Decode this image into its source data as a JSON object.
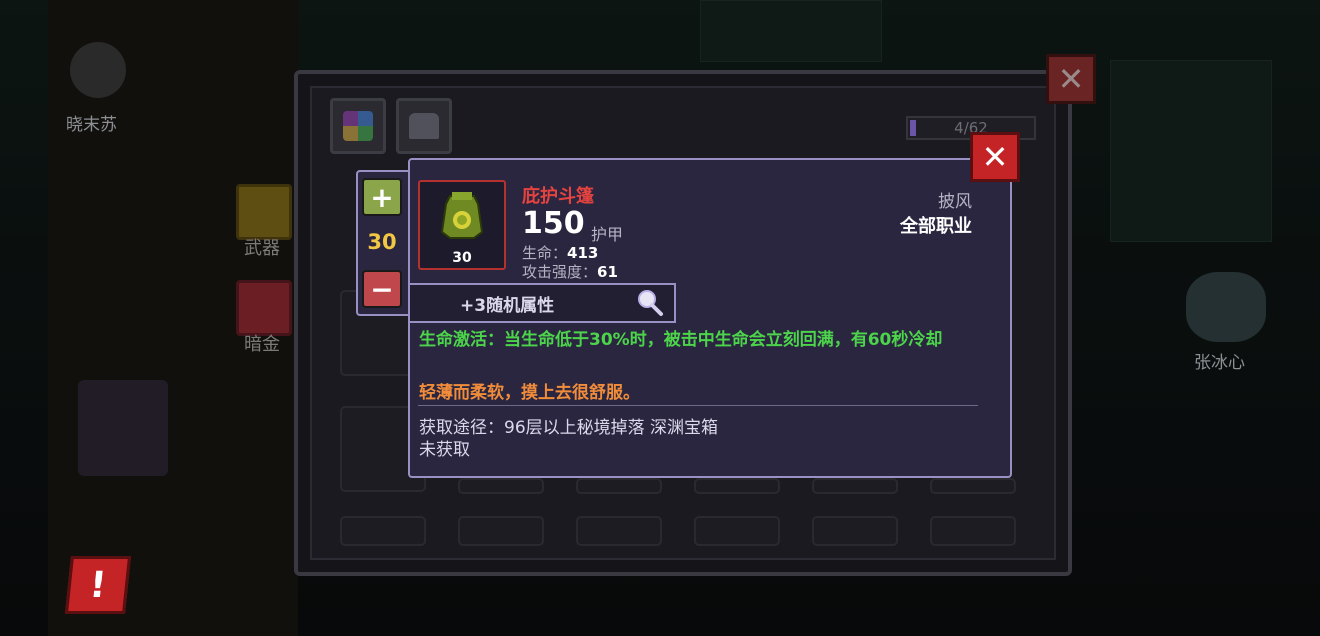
{
  "background": {
    "characters": [
      {
        "name": "晓末苏"
      },
      {
        "name": "张冰心"
      }
    ],
    "side_tabs": [
      {
        "label": "武器"
      },
      {
        "label": "暗金"
      }
    ]
  },
  "inventory": {
    "progress_text": "4/62"
  },
  "tooltip": {
    "item_name": "庇护斗篷",
    "item_level": "30",
    "armor_value": "150",
    "armor_label": "护甲",
    "stats": [
      {
        "label": "生命：",
        "value": "413"
      },
      {
        "label": "攻击强度：",
        "value": "61"
      }
    ],
    "slot_type": "披风",
    "class_restriction": "全部职业",
    "random_attributes": "+3随机属性",
    "effect_text": "生命激活：当生命低于30%时，被击中生命会立刻回满，有60秒冷却",
    "flavor_text": "轻薄而柔软，摸上去很舒服。",
    "source_text": "获取途径：96层以上秘境掉落 深渊宝箱",
    "obtain_status": "未获取"
  },
  "quantity": {
    "value": "30",
    "plus_icon": "plus-icon",
    "minus_icon": "minus-icon"
  },
  "buttons": {
    "close_glyph": "✕",
    "warning_glyph": "!"
  },
  "colors": {
    "item_name": "#e5433f",
    "effect": "#4cd44a",
    "flavor": "#f08c3a",
    "quantity": "#f2c744",
    "tooltip_border": "#9a90c4"
  }
}
